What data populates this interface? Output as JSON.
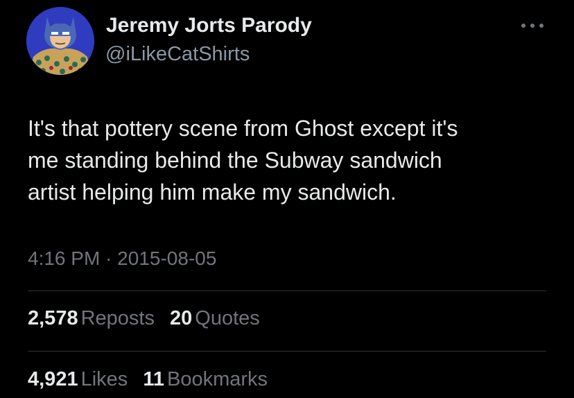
{
  "author": {
    "name": "Jeremy Jorts Parody",
    "handle": "@iLikeCatShirts"
  },
  "tweet": {
    "text": "It's that pottery scene from Ghost except it's\nme standing behind the Subway sandwich\nartist helping him make my sandwich.",
    "time": "4:16 PM",
    "separator": "·",
    "date": "2015-08-05"
  },
  "stats": {
    "reposts": {
      "count": "2,578",
      "label": "Reposts"
    },
    "quotes": {
      "count": "20",
      "label": "Quotes"
    },
    "likes": {
      "count": "4,921",
      "label": "Likes"
    },
    "bookmarks": {
      "count": "11",
      "label": "Bookmarks"
    }
  },
  "icons": {
    "more": "more-options-icon",
    "avatar": "batman-avatar"
  },
  "colors": {
    "background": "#000000",
    "primary_text": "#e7e9ea",
    "secondary_text": "#71767b",
    "divider": "#2f3336"
  }
}
